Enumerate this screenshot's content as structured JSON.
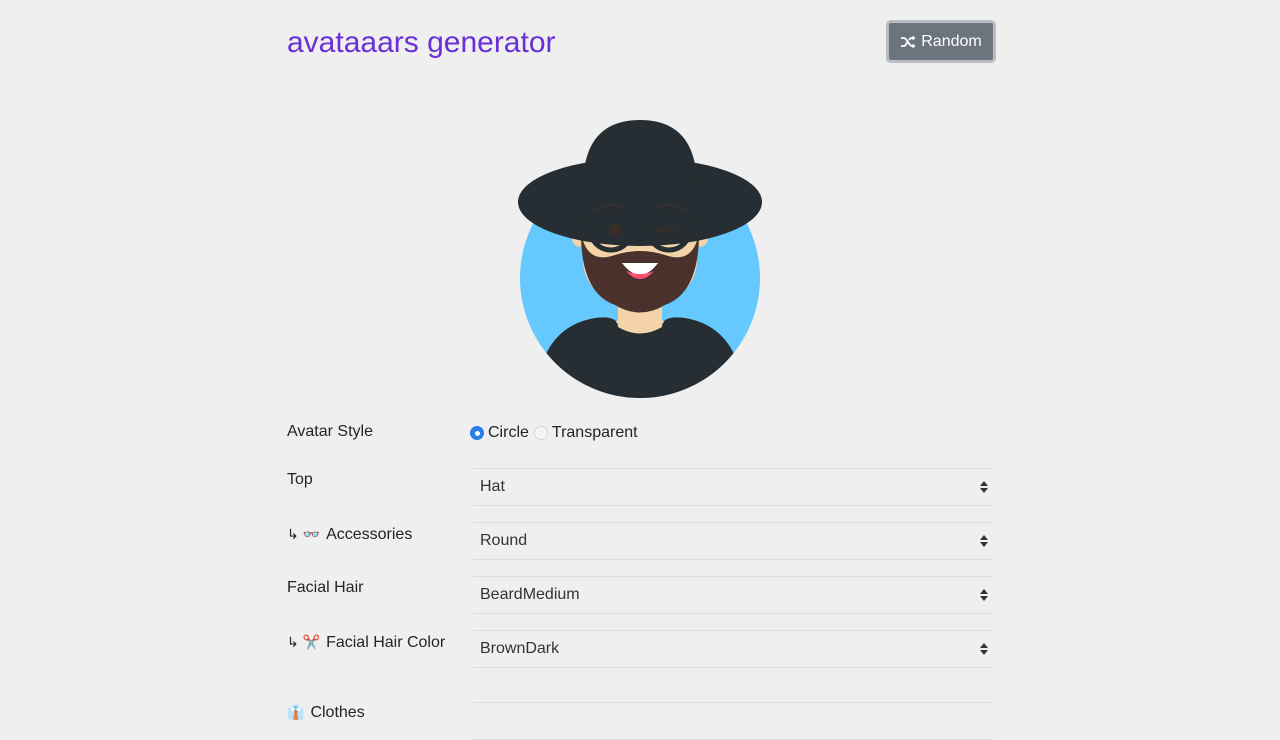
{
  "header": {
    "title": "avataaars generator",
    "random_label": "Random"
  },
  "colors": {
    "title": "#6a2fd8",
    "button_bg": "#6c757d",
    "avatar_circle": "#65c9ff",
    "radio_checked": "#2b7de9"
  },
  "avatar": {
    "style": "Circle",
    "top": "Hat",
    "accessories": "Round",
    "facial_hair": "BeardMedium",
    "facial_hair_color": "BrownDark"
  },
  "form": {
    "avatar_style": {
      "label": "Avatar Style",
      "options": [
        "Circle",
        "Transparent"
      ],
      "selected": "Circle"
    },
    "top": {
      "label": "Top",
      "value": "Hat"
    },
    "accessories": {
      "prefix": "↳ 👓",
      "label": "Accessories",
      "value": "Round"
    },
    "facial_hair": {
      "label": "Facial Hair",
      "value": "BeardMedium"
    },
    "facial_hair_color": {
      "prefix": "↳ ✂️",
      "label": "Facial Hair Color",
      "value": "BrownDark"
    },
    "clothes": {
      "prefix": "👔",
      "label": "Clothes"
    }
  }
}
